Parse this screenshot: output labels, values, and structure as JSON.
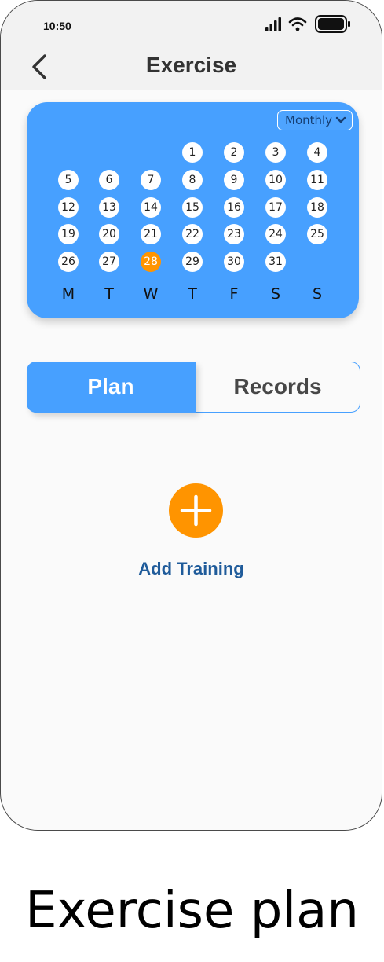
{
  "status_bar": {
    "time": "10:50"
  },
  "header": {
    "title": "Exercise"
  },
  "calendar": {
    "view_selector": "Monthly",
    "days": [
      "1",
      "2",
      "3",
      "4",
      "5",
      "6",
      "7",
      "8",
      "9",
      "10",
      "11",
      "12",
      "13",
      "14",
      "15",
      "16",
      "17",
      "18",
      "19",
      "20",
      "21",
      "22",
      "23",
      "24",
      "25",
      "26",
      "27",
      "28",
      "29",
      "30",
      "31"
    ],
    "today": "28",
    "weekdays": [
      "M",
      "T",
      "W",
      "T",
      "F",
      "S",
      "S"
    ]
  },
  "tabs": {
    "plan": "Plan",
    "records": "Records",
    "active": "Plan"
  },
  "actions": {
    "add_training": "Add Training"
  },
  "caption": "Exercise plan",
  "colors": {
    "primary": "#47a0ff",
    "accent": "#ff9400",
    "link": "#1f5b9a"
  }
}
